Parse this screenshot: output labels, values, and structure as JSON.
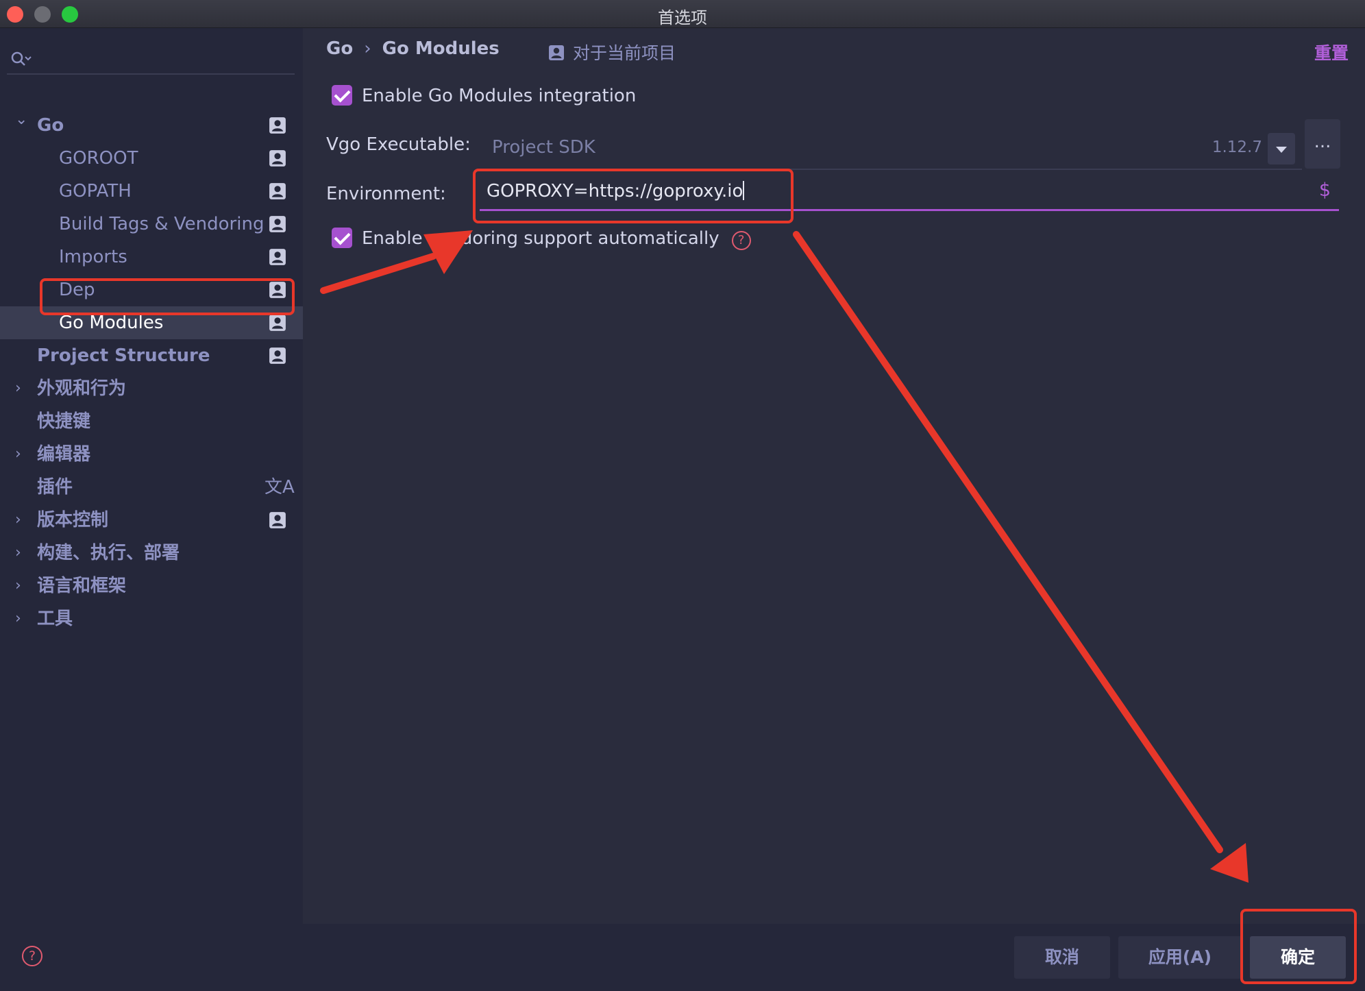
{
  "window": {
    "title": "首选项"
  },
  "sidebar": {
    "search": {
      "value": "",
      "placeholder": ""
    },
    "items": [
      {
        "label": "Go",
        "level": 0,
        "expandable": true,
        "expanded": true,
        "icon": "project-icon"
      },
      {
        "label": "GOROOT",
        "level": 1,
        "icon": "project-icon"
      },
      {
        "label": "GOPATH",
        "level": 1,
        "icon": "project-icon"
      },
      {
        "label": "Build Tags & Vendoring",
        "level": 1,
        "icon": "project-icon"
      },
      {
        "label": "Imports",
        "level": 1,
        "icon": "project-icon"
      },
      {
        "label": "Dep",
        "level": 1,
        "icon": "project-icon"
      },
      {
        "label": "Go Modules",
        "level": 1,
        "icon": "project-icon",
        "selected": true
      },
      {
        "label": "Project Structure",
        "level": 0,
        "icon": "project-icon"
      },
      {
        "label": "外观和行为",
        "level": 0,
        "expandable": true
      },
      {
        "label": "快捷键",
        "level": 0
      },
      {
        "label": "编辑器",
        "level": 0,
        "expandable": true
      },
      {
        "label": "插件",
        "level": 0,
        "icon": "translate-icon",
        "icon_glyph": "文A"
      },
      {
        "label": "版本控制",
        "level": 0,
        "expandable": true,
        "icon": "project-icon"
      },
      {
        "label": "构建、执行、部署",
        "level": 0,
        "expandable": true
      },
      {
        "label": "语言和框架",
        "level": 0,
        "expandable": true
      },
      {
        "label": "工具",
        "level": 0,
        "expandable": true
      }
    ]
  },
  "header": {
    "breadcrumb": [
      "Go",
      "Go Modules"
    ],
    "breadcrumb_separator": "›",
    "scope_label": "对于当前项目",
    "reset_label": "重置"
  },
  "settings": {
    "enable_modules": {
      "label": "Enable Go Modules integration",
      "checked": true
    },
    "vgo": {
      "label": "Vgo Executable:",
      "value": "Project SDK",
      "version": "1.12.7",
      "more": "..."
    },
    "environment": {
      "label": "Environment:",
      "value": "GOPROXY=https://goproxy.io",
      "dollar": "$"
    },
    "vendoring": {
      "label": "Enable vendoring support automatically",
      "checked": true,
      "help": "?"
    }
  },
  "footer": {
    "help": "?",
    "cancel_label": "取消",
    "apply_label": "应用(A)",
    "ok_label": "确定"
  },
  "colors": {
    "accent": "#a651cf",
    "annotation": "#e8372a",
    "background": "#2a2c3d",
    "sidebar": "#25273a"
  }
}
